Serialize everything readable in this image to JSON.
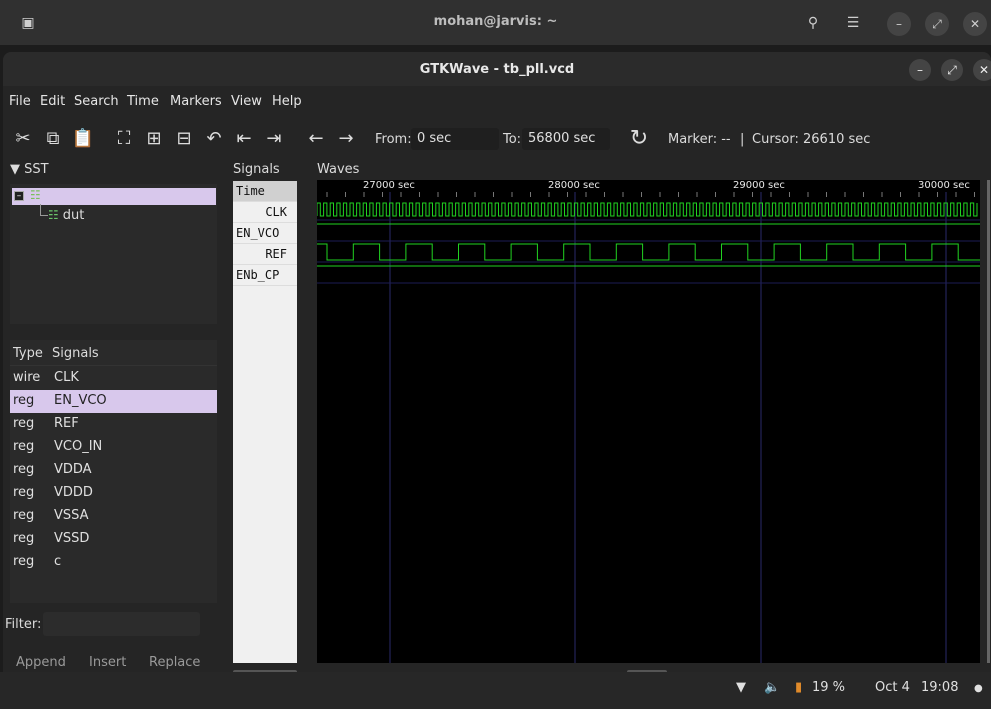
{
  "terminal": {
    "title": "mohan@jarvis: ~"
  },
  "window": {
    "title": "GTKWave - tb_pll.vcd"
  },
  "menu": [
    "File",
    "Edit",
    "Search",
    "Time",
    "Markers",
    "View",
    "Help"
  ],
  "toolbar": {
    "from_label": "From:",
    "from_value": "0 sec",
    "to_label": "To:",
    "to_value": "56800 sec",
    "marker": "Marker: --",
    "separator": "|",
    "cursor": "Cursor: 26610 sec"
  },
  "sst": {
    "header": "SST",
    "child": "dut"
  },
  "signal_list": {
    "col_type": "Type",
    "col_signals": "Signals",
    "rows": [
      {
        "type": "wire",
        "name": "CLK"
      },
      {
        "type": "reg",
        "name": "EN_VCO"
      },
      {
        "type": "reg",
        "name": "REF"
      },
      {
        "type": "reg",
        "name": "VCO_IN"
      },
      {
        "type": "reg",
        "name": "VDDA"
      },
      {
        "type": "reg",
        "name": "VDDD"
      },
      {
        "type": "reg",
        "name": "VSSA"
      },
      {
        "type": "reg",
        "name": "VSSD"
      },
      {
        "type": "reg",
        "name": "c"
      }
    ],
    "selected_index": 1
  },
  "filter": {
    "label": "Filter:"
  },
  "buttons": {
    "append": "Append",
    "insert": "Insert",
    "replace": "Replace"
  },
  "signals_pane": {
    "header": "Signals",
    "names": [
      "Time",
      "CLK",
      "EN_VCO",
      "REF",
      "ENb_CP"
    ]
  },
  "waves_pane": {
    "header": "Waves",
    "ticks": [
      "27000 sec",
      "28000 sec",
      "29000 sec",
      "30000 sec"
    ]
  },
  "colors": {
    "wave": "#21d321",
    "selection": "#d8c8ec",
    "grid": "#2a2a6a"
  },
  "status": {
    "battery": "19 %",
    "date": "Oct 4",
    "time": "19:08"
  }
}
